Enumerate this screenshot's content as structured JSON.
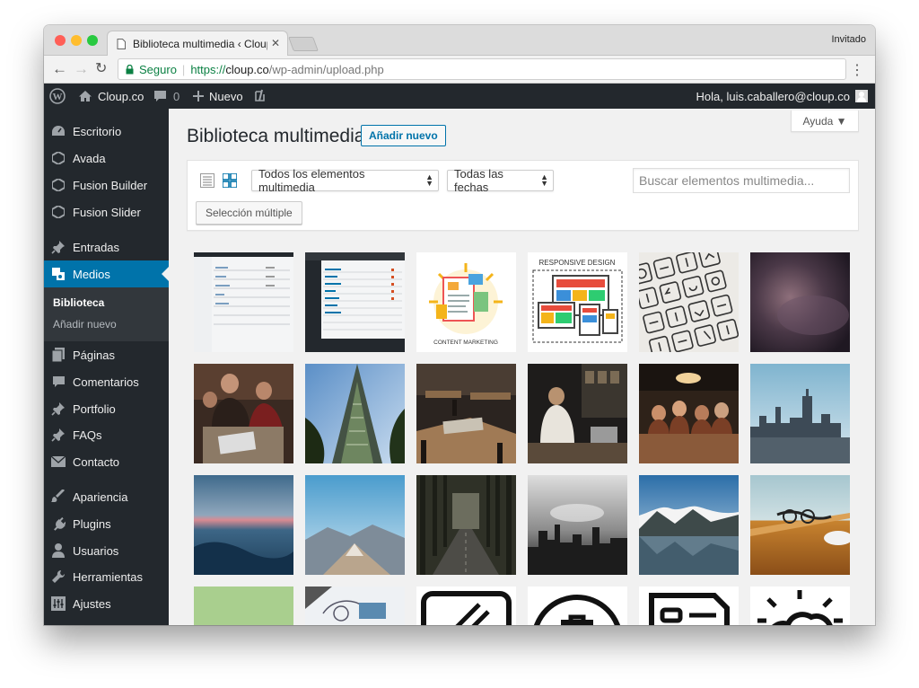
{
  "browser": {
    "tab_title": "Biblioteca multimedia ‹ Cloup.co",
    "guest_label": "Invitado",
    "secure_label": "Seguro",
    "url_protocol": "https://",
    "url_host": "cloup.co",
    "url_path": "/wp-admin/upload.php",
    "traffic_colors": [
      "#ff5f57",
      "#ffbd2e",
      "#28c940"
    ]
  },
  "adminbar": {
    "site_name": "Cloup.co",
    "comments_count": "0",
    "new_label": "Nuevo",
    "greeting": "Hola, luis.caballero@cloup.co"
  },
  "sidebar": {
    "items": [
      {
        "label": "Escritorio",
        "icon": "dashboard-icon"
      },
      {
        "label": "Avada",
        "icon": "avada-icon"
      },
      {
        "label": "Fusion Builder",
        "icon": "fusion-builder-icon"
      },
      {
        "label": "Fusion Slider",
        "icon": "fusion-slider-icon"
      },
      {
        "label": "Entradas",
        "icon": "pin-icon"
      },
      {
        "label": "Medios",
        "icon": "media-icon"
      },
      {
        "label": "Páginas",
        "icon": "pages-icon"
      },
      {
        "label": "Comentarios",
        "icon": "comments-icon"
      },
      {
        "label": "Portfolio",
        "icon": "pin-icon"
      },
      {
        "label": "FAQs",
        "icon": "pin-icon"
      },
      {
        "label": "Contacto",
        "icon": "mail-icon"
      },
      {
        "label": "Apariencia",
        "icon": "brush-icon"
      },
      {
        "label": "Plugins",
        "icon": "plugin-icon"
      },
      {
        "label": "Usuarios",
        "icon": "user-icon"
      },
      {
        "label": "Herramientas",
        "icon": "wrench-icon"
      },
      {
        "label": "Ajustes",
        "icon": "settings-icon"
      }
    ],
    "submenu": [
      "Biblioteca",
      "Añadir nuevo"
    ]
  },
  "page": {
    "help_label": "Ayuda ▼",
    "title": "Biblioteca multimedia",
    "add_new_label": "Añadir nuevo",
    "filter_type": "Todos los elementos multimedia",
    "filter_date": "Todas las fechas",
    "search_placeholder": "Buscar elementos multimedia...",
    "bulk_select_label": "Selección múltiple"
  },
  "attachments": [
    "screenshot-1",
    "screenshot-2",
    "content-marketing",
    "responsive-design",
    "icon-sketch",
    "purple-blur",
    "people-meeting",
    "tall-building",
    "restaurant-tables",
    "cafe-barista",
    "dinner-group",
    "city-skyline",
    "sea-sunset",
    "mountain-summit",
    "forest-road",
    "foggy-city",
    "lake-mountains",
    "desk-glasses",
    "green-blank",
    "sketch-paper",
    "card-icon",
    "shop-icon",
    "document-icon",
    "cloud-icon"
  ],
  "thumb_text": {
    "content_marketing": "CONTENT MARKETING",
    "responsive_design": "RESPONSIVE DESIGN"
  },
  "colors": {
    "admin_dark": "#23282d",
    "admin_blue": "#0073aa",
    "submenu_bg": "#32373c"
  }
}
